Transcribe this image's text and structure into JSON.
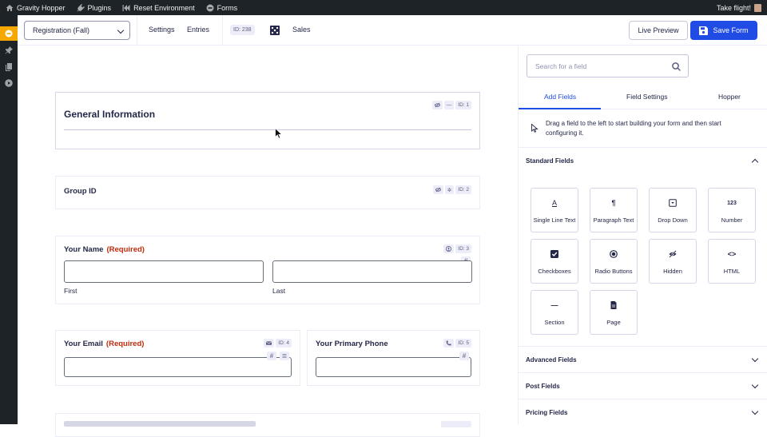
{
  "admin_bar": {
    "site_name": "Gravity Hopper",
    "plugins": "Plugins",
    "reset_env": "Reset Environment",
    "forms": "Forms",
    "greeting": "Take flight!"
  },
  "toolbar": {
    "form_selected": "Registration (Fall)",
    "settings": "Settings",
    "entries": "Entries",
    "form_id": "ID: 238",
    "sales": "Sales",
    "live_preview": "Live Preview",
    "save_form": "Save Form"
  },
  "canvas": {
    "section": {
      "title": "General Information",
      "id": "ID: 1"
    },
    "group": {
      "label": "Group ID",
      "id": "ID: 2"
    },
    "name": {
      "label": "Your Name",
      "required": "(Required)",
      "id": "ID: 3",
      "first": "First",
      "last": "Last"
    },
    "email": {
      "label": "Your Email",
      "required": "(Required)",
      "id": "ID: 4"
    },
    "phone": {
      "label": "Your Primary Phone",
      "id": "ID: 5"
    },
    "hash": "#"
  },
  "sidebar": {
    "search_placeholder": "Search for a field",
    "tabs": [
      "Add Fields",
      "Field Settings",
      "Hopper"
    ],
    "hint": "Drag a field to the left to start building your form and then start configuring it.",
    "standard_fields": "Standard Fields",
    "fields": [
      {
        "label": "Single Line Text",
        "icon": "A"
      },
      {
        "label": "Paragraph Text",
        "icon": "¶"
      },
      {
        "label": "Drop Down",
        "icon": "dropdown-icon"
      },
      {
        "label": "Number",
        "icon": "123"
      },
      {
        "label": "Checkboxes",
        "icon": "checkbox-icon"
      },
      {
        "label": "Radio Buttons",
        "icon": "radio-icon"
      },
      {
        "label": "Hidden",
        "icon": "eye-slash-icon"
      },
      {
        "label": "HTML",
        "icon": "<>"
      },
      {
        "label": "Section",
        "icon": "—"
      },
      {
        "label": "Page",
        "icon": "page-icon"
      }
    ],
    "advanced_fields": "Advanced Fields",
    "post_fields": "Post Fields",
    "pricing_fields": "Pricing Fields"
  },
  "colors": {
    "accent": "#204ce5",
    "required": "#c02b0a",
    "admin_bar": "#1d2327",
    "active_menu": "#f6a800"
  }
}
